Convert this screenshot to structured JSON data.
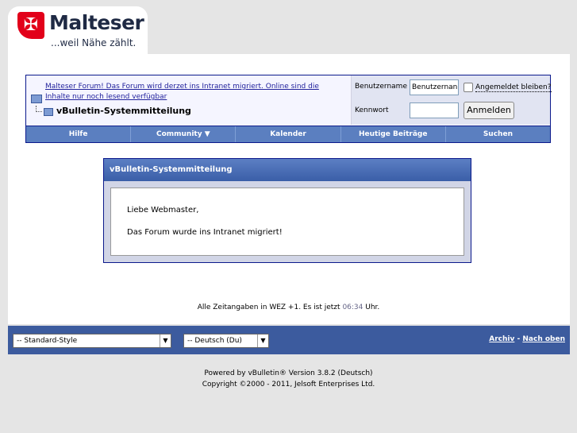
{
  "logo": {
    "brand": "Malteser",
    "slogan": "...weil Nähe zählt.",
    "cross_glyph": "✠",
    "brand_color": "#e2001a"
  },
  "navbar": {
    "forum_link": "Malteser Forum! Das Forum wird derzet ins Intranet migriert. Online sind die Inhalte nur noch lesend verfügbar",
    "current_page": "vBulletin-Systemmitteilung",
    "username_label": "Benutzername",
    "username_value": "Benutzernan",
    "password_label": "Kennwort",
    "remember_label": "Angemeldet bleiben?",
    "login_button": "Anmelden"
  },
  "menu": {
    "items": [
      "Hilfe",
      "Community ▼",
      "Kalender",
      "Heutige Beiträge",
      "Suchen"
    ]
  },
  "system_message": {
    "title": "vBulletin-Systemmitteilung",
    "greeting": "Liebe Webmaster,",
    "message": "Das Forum wurde ins Intranet migriert!"
  },
  "timezone": {
    "prefix": "Alle Zeitangaben in WEZ +1. Es ist jetzt",
    "time": "06:34",
    "suffix": "Uhr."
  },
  "footer": {
    "style_select": "-- Standard-Style",
    "language_select": "-- Deutsch (Du)",
    "archive_link": "Archiv",
    "separator": "-",
    "top_link": "Nach oben"
  },
  "copyright": {
    "line1": "Powered by vBulletin® Version 3.8.2 (Deutsch)",
    "line2": "Copyright ©2000 - 2011, Jelsoft Enterprises Ltd."
  }
}
